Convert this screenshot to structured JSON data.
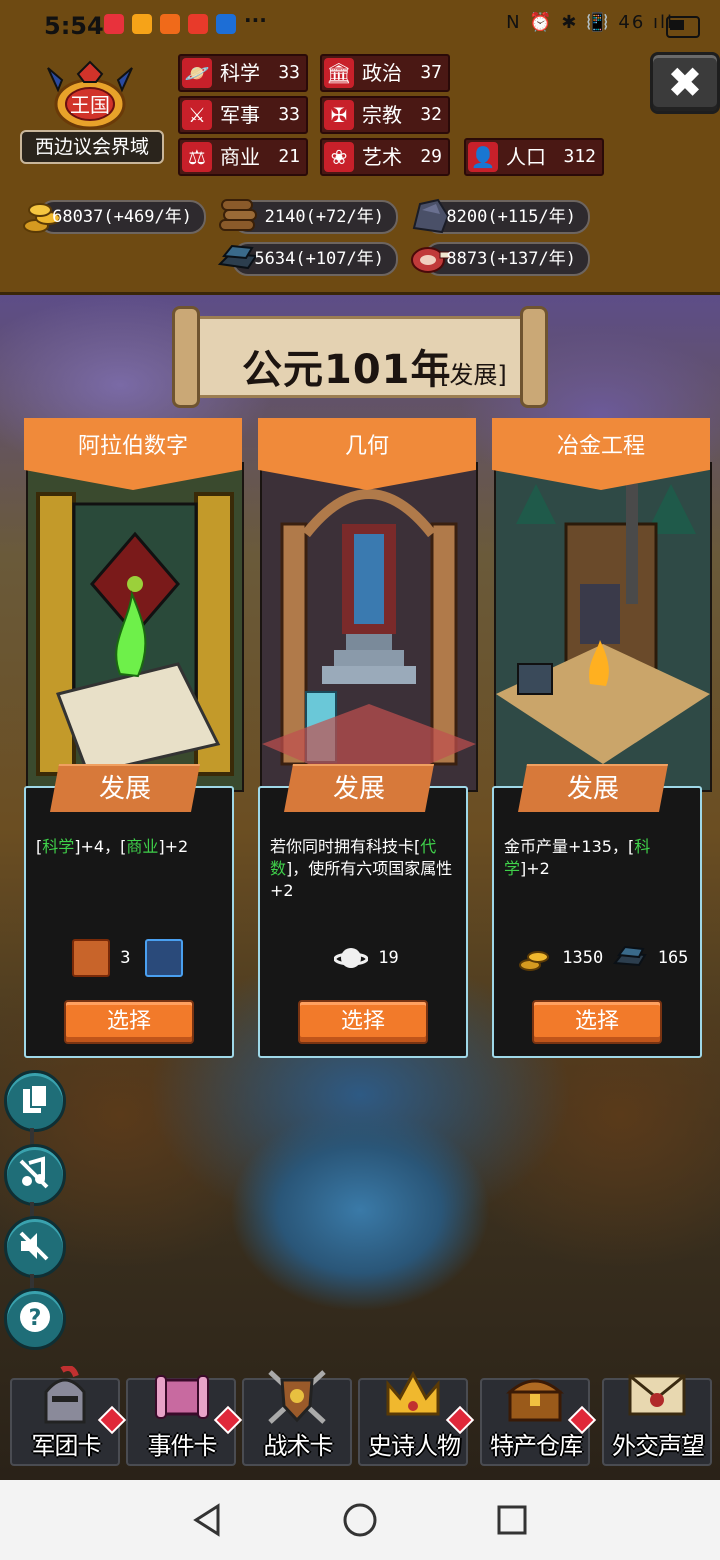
{
  "status_bar": {
    "time": "5:54",
    "more": "···",
    "right_icons": "N ⏰ ✱ 📳 46 ıll"
  },
  "header": {
    "emblem_label": "王国",
    "kingdom_name": "西边议会界域",
    "stats": [
      {
        "label": "科学",
        "value": "33",
        "icon": "planet-icon"
      },
      {
        "label": "政治",
        "value": "37",
        "icon": "capitol-icon"
      },
      {
        "label": "军事",
        "value": "33",
        "icon": "crossed-swords-icon"
      },
      {
        "label": "宗教",
        "value": "32",
        "icon": "fleur-cross-icon"
      },
      {
        "label": "商业",
        "value": "21",
        "icon": "scales-icon"
      },
      {
        "label": "艺术",
        "value": "29",
        "icon": "lotus-icon"
      },
      {
        "label": "人口",
        "value": "312",
        "icon": "person-icon"
      }
    ],
    "resources": [
      {
        "text": "68037(+469/年)",
        "icon": "gold-coins-icon"
      },
      {
        "text": "2140(+72/年)",
        "icon": "wood-logs-icon"
      },
      {
        "text": "8200(+115/年)",
        "icon": "stone-icon"
      },
      {
        "text": "5634(+107/年)",
        "icon": "iron-ingot-icon"
      },
      {
        "text": "8873(+137/年)",
        "icon": "meat-icon"
      }
    ],
    "close_icon": "✖"
  },
  "era": {
    "year": "公元101年",
    "phase": "[发展]"
  },
  "cards": [
    {
      "title": "阿拉伯数字",
      "type": "发展",
      "desc_parts": [
        "[",
        "科学",
        "]+4，[",
        "商业",
        "]+2"
      ],
      "cost_a_value": "3",
      "button": "选择"
    },
    {
      "title": "几何",
      "type": "发展",
      "desc_parts": [
        "若你同时拥有科技卡[",
        "代数",
        "]，使所有六项国家属性+2"
      ],
      "cost_a_value": "19",
      "button": "选择"
    },
    {
      "title": "冶金工程",
      "type": "发展",
      "desc_parts": [
        "金币产量+135，[",
        "科学",
        "]+2"
      ],
      "cost_a_value": "1350",
      "cost_b_value": "165",
      "button": "选择"
    }
  ],
  "side_buttons": [
    "card-deck-icon",
    "no-music-icon",
    "mute-icon",
    "help-icon"
  ],
  "help_glyph": "?",
  "bottom_nav": [
    {
      "label": "军团卡",
      "icon": "knight-helmet-icon"
    },
    {
      "label": "事件卡",
      "icon": "scroll-icon"
    },
    {
      "label": "战术卡",
      "icon": "shield-swords-icon"
    },
    {
      "label": "史诗人物",
      "icon": "crown-icon"
    },
    {
      "label": "特产仓库",
      "icon": "treasure-chest-icon"
    },
    {
      "label": "外交声望",
      "icon": "sealed-letter-icon"
    }
  ],
  "colors": {
    "header_bg": "#6e4a12",
    "stat_bg": "#4a1814",
    "stat_icon": "#c8202a",
    "card_title": "#f08a3a",
    "select_button": "#f27a2a",
    "highlight": "#3fd04a",
    "card_border": "#9fd8e8"
  }
}
